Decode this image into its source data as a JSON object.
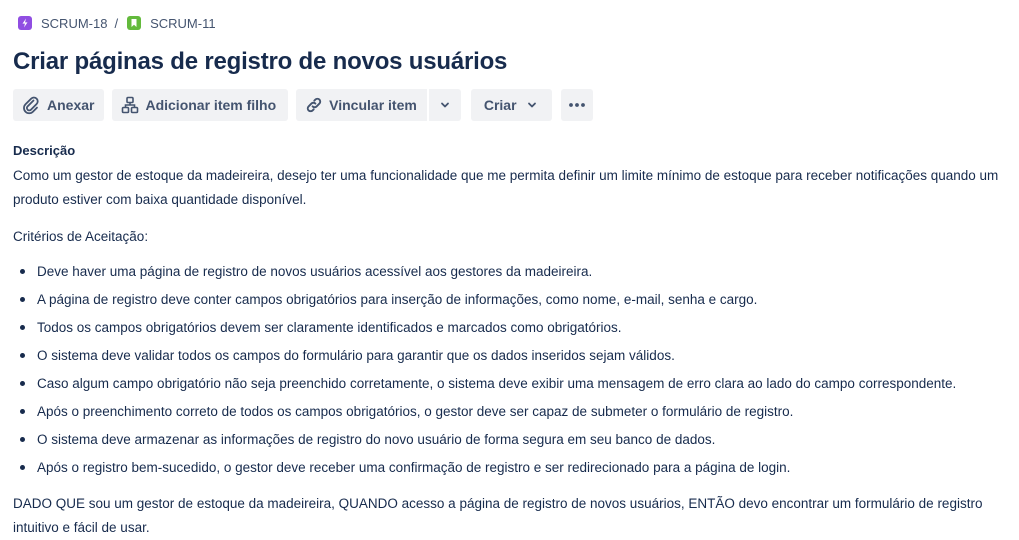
{
  "breadcrumb": {
    "items": [
      {
        "key": "SCRUM-18",
        "type": "epic",
        "icon": "lightning-icon",
        "color": "#904ee2"
      },
      {
        "key": "SCRUM-11",
        "type": "story",
        "icon": "bookmark-icon",
        "color": "#63ba3c"
      }
    ],
    "separator": "/"
  },
  "issue": {
    "title": "Criar páginas de registro de novos usuários"
  },
  "toolbar": {
    "attach_label": "Anexar",
    "add_child_label": "Adicionar item filho",
    "link_label": "Vincular item",
    "create_label": "Criar"
  },
  "description": {
    "label": "Descrição",
    "intro": "Como um gestor de estoque da madeireira, desejo ter uma funcionalidade que me permita definir um limite mínimo de estoque para receber notificações quando um produto estiver com baixa quantidade disponível.",
    "criteria_heading": "Critérios de Aceitação:",
    "criteria": [
      "Deve haver uma página de registro de novos usuários acessível aos gestores da madeireira.",
      "A página de registro deve conter campos obrigatórios para inserção de informações, como nome, e-mail, senha e cargo.",
      "Todos os campos obrigatórios devem ser claramente identificados e marcados como obrigatórios.",
      "O sistema deve validar todos os campos do formulário para garantir que os dados inseridos sejam válidos.",
      "Caso algum campo obrigatório não seja preenchido corretamente, o sistema deve exibir uma mensagem de erro clara ao lado do campo correspondente.",
      "Após o preenchimento correto de todos os campos obrigatórios, o gestor deve ser capaz de submeter o formulário de registro.",
      "O sistema deve armazenar as informações de registro do novo usuário de forma segura em seu banco de dados.",
      "Após o registro bem-sucedido, o gestor deve receber uma confirmação de registro e ser redirecionado para a página de login."
    ],
    "given_when_then": "DADO QUE sou um gestor de estoque da madeireira, QUANDO acesso a página de registro de novos usuários, ENTÃO devo encontrar um formulário de registro intuitivo e fácil de usar."
  }
}
